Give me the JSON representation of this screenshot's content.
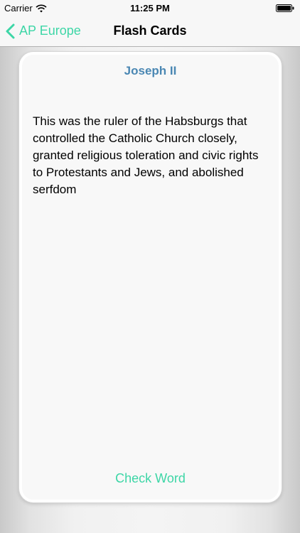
{
  "status_bar": {
    "carrier": "Carrier",
    "time": "11:25 PM"
  },
  "nav": {
    "back_label": "AP Europe",
    "title": "Flash Cards"
  },
  "card": {
    "term": "Joseph II",
    "definition": "This was the ruler of the Habsburgs that controlled the Catholic Church closely, granted religious toleration and civic rights to Protestants and Jews, and abolished serfdom",
    "action_label": "Check Word"
  },
  "icons": {
    "wifi": "wifi-icon",
    "battery": "battery-icon",
    "back": "chevron-left-icon"
  },
  "colors": {
    "accent": "#3dd6a6",
    "term": "#4a87b3"
  }
}
